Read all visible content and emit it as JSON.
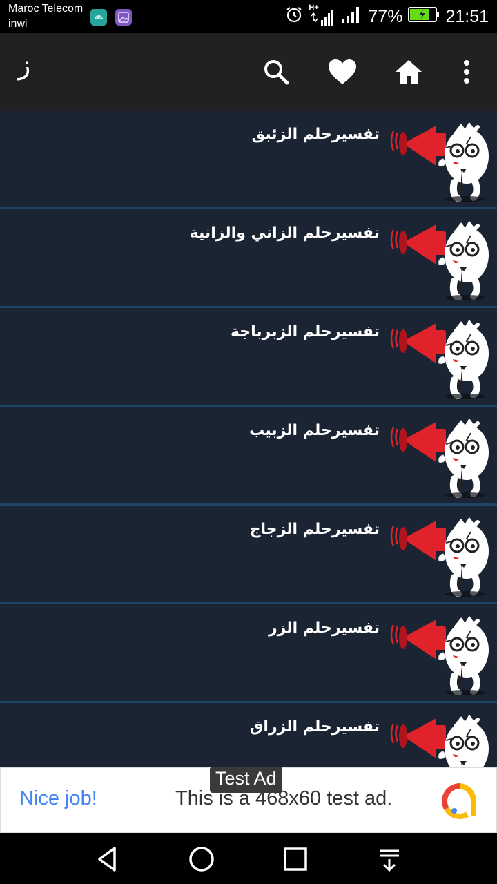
{
  "status_bar": {
    "carrier_primary": "Maroc Telecom",
    "carrier_secondary": "inwi",
    "network": "H+",
    "battery": "77%",
    "time": "21:51",
    "battery_fill": 0.77
  },
  "app_bar": {
    "title": "ز",
    "icons": [
      "search-icon",
      "heart-icon",
      "home-icon",
      "more-vert-icon"
    ]
  },
  "list": {
    "items": [
      {
        "label": "تفسيرحلم الزئبق"
      },
      {
        "label": "تفسيرحلم الزاني والزانية"
      },
      {
        "label": "تفسيرحلم الزبرباجة"
      },
      {
        "label": "تفسيرحلم الزبيب"
      },
      {
        "label": "تفسيرحلم الزجاج"
      },
      {
        "label": "تفسيرحلم الزر"
      },
      {
        "label": "تفسيرحلم الزراق"
      }
    ]
  },
  "ad": {
    "tag": "Test Ad",
    "headline": "Nice job!",
    "body": "This is a 468x60 test ad."
  },
  "colors": {
    "list_bg": "#1b2432",
    "divider": "#1e4466",
    "app_bar": "#212121",
    "megaphone_red": "#e0232b"
  }
}
